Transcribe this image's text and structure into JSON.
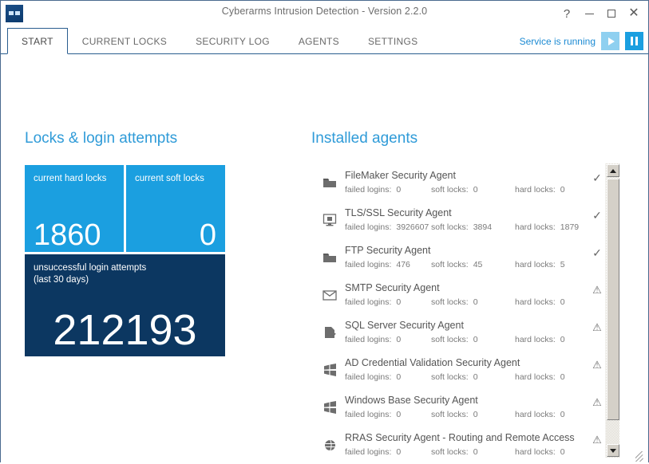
{
  "window": {
    "title": "Cyberarms Intrusion Detection - Version 2.2.0",
    "app_icon": "shield-eyes-icon",
    "controls": {
      "help": "?",
      "minimize": "minimize-icon",
      "maximize": "maximize-icon",
      "close": "✕"
    }
  },
  "tabs": [
    {
      "label": "START",
      "active": true
    },
    {
      "label": "CURRENT LOCKS",
      "active": false
    },
    {
      "label": "SECURITY LOG",
      "active": false
    },
    {
      "label": "AGENTS",
      "active": false
    },
    {
      "label": "SETTINGS",
      "active": false
    }
  ],
  "service": {
    "status_text": "Service is running",
    "play_label": "start-service",
    "pause_label": "pause-service"
  },
  "left_panel": {
    "heading": "Locks & login attempts",
    "tiles": [
      {
        "label": "current hard locks",
        "value": "1860",
        "color": "#1b9fe0"
      },
      {
        "label": "current soft locks",
        "value": "0",
        "color": "#1b9fe0"
      },
      {
        "label": "unsuccessful login attempts\n(last 30 days)",
        "label_line1": "unsuccessful login attempts",
        "label_line2": "(last 30 days)",
        "value": "212193",
        "color": "#0c3761"
      }
    ]
  },
  "right_panel": {
    "heading": "Installed agents",
    "stat_labels": {
      "failed": "failed logins:",
      "soft": "soft locks:",
      "hard": "hard locks:"
    },
    "agents": [
      {
        "name": "FileMaker Security Agent",
        "icon": "folder-icon",
        "failed_logins": "0",
        "soft_locks": "0",
        "hard_locks": "0",
        "status": "ok",
        "status_glyph": "✓"
      },
      {
        "name": "TLS/SSL Security Agent",
        "icon": "monitor-icon",
        "failed_logins": "3926607",
        "soft_locks": "3894",
        "hard_locks": "1879",
        "status": "ok",
        "status_glyph": "✓"
      },
      {
        "name": "FTP Security Agent",
        "icon": "folder-icon",
        "failed_logins": "476",
        "soft_locks": "45",
        "hard_locks": "5",
        "status": "ok",
        "status_glyph": "✓"
      },
      {
        "name": "SMTP Security Agent",
        "icon": "envelope-icon",
        "failed_logins": "0",
        "soft_locks": "0",
        "hard_locks": "0",
        "status": "warning",
        "status_glyph": "⚠"
      },
      {
        "name": "SQL Server Security Agent",
        "icon": "database-document-icon",
        "failed_logins": "0",
        "soft_locks": "0",
        "hard_locks": "0",
        "status": "warning",
        "status_glyph": "⚠"
      },
      {
        "name": "AD Credential Validation Security Agent",
        "icon": "windows-flag-icon",
        "failed_logins": "0",
        "soft_locks": "0",
        "hard_locks": "0",
        "status": "warning",
        "status_glyph": "⚠"
      },
      {
        "name": "Windows Base Security Agent",
        "icon": "windows-flag-icon",
        "failed_logins": "0",
        "soft_locks": "0",
        "hard_locks": "0",
        "status": "warning",
        "status_glyph": "⚠"
      },
      {
        "name": "RRAS Security Agent - Routing and Remote Access",
        "icon": "globe-icon",
        "failed_logins": "0",
        "soft_locks": "0",
        "hard_locks": "0",
        "status": "warning",
        "status_glyph": "⚠"
      }
    ]
  },
  "colors": {
    "accent": "#1b9fe0",
    "heading": "#2f9bd8",
    "dark_tile": "#0c3761",
    "window_border": "#4a6a8f",
    "tab_border": "#2a5d8f"
  }
}
